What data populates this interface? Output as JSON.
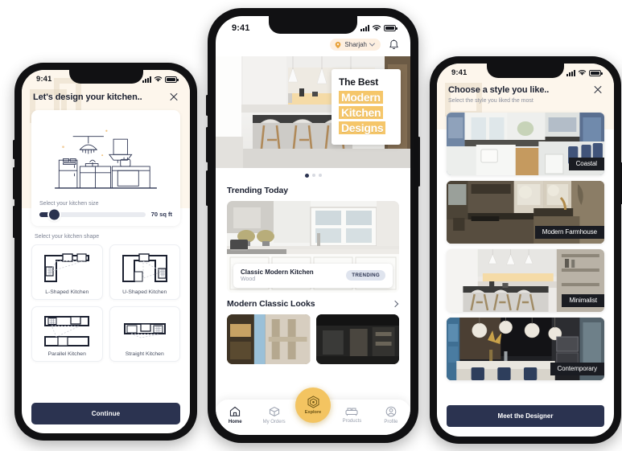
{
  "app": {
    "accent_yellow": "#f3c461",
    "navy": "#2b3350",
    "cream": "#fdf6ec"
  },
  "left_phone": {
    "status": {
      "time": "9:41",
      "signal_icon": "signal-bars-icon",
      "wifi_icon": "wifi-icon",
      "battery_icon": "battery-icon"
    },
    "header": {
      "title": "Let's design your kitchen..",
      "close_icon": "close-icon"
    },
    "illustration": {
      "name": "kitchen-line-illustration"
    },
    "size": {
      "label": "Select your kitchen size",
      "value": "70 sq ft",
      "slider_percent": 13
    },
    "shape": {
      "label": "Select your kitchen shape",
      "options": [
        {
          "name": "L-Shaped Kitchen",
          "icon": "l-shape-icon"
        },
        {
          "name": "U-Shaped Kitchen",
          "icon": "u-shape-icon"
        },
        {
          "name": "Parallel Kitchen",
          "icon": "parallel-shape-icon"
        },
        {
          "name": "Straight Kitchen",
          "icon": "straight-shape-icon"
        }
      ]
    },
    "cta": "Continue"
  },
  "center_phone": {
    "status": {
      "time": "9:41"
    },
    "topbar": {
      "location": "Sharjah",
      "location_icon": "location-pin-icon",
      "chevron_icon": "chevron-down-icon",
      "bell_icon": "notification-bell-icon"
    },
    "hero": {
      "image": "modern-kitchen-hero-photo",
      "tag_line1": "The Best",
      "tag_line2": "Modern",
      "tag_line3": "Kitchen",
      "tag_line4": "Designs",
      "dots_total": 3,
      "dots_active": 1
    },
    "trending": {
      "title": "Trending Today",
      "card": {
        "image": "classic-white-kitchen-photo",
        "name": "Classic Modern Kitchen",
        "material": "Wood",
        "badge": "TRENDING"
      }
    },
    "looks": {
      "title": "Modern Classic Looks",
      "chevron_icon": "chevron-right-icon",
      "cards": [
        {
          "image": "warm-wood-interior-photo"
        },
        {
          "image": "dark-modern-interior-photo"
        }
      ]
    },
    "tabbar": {
      "items": [
        {
          "label": "Home",
          "icon": "home-icon",
          "active": true
        },
        {
          "label": "My Orders",
          "icon": "box-icon",
          "active": false
        },
        {
          "label": "Products",
          "icon": "sofa-icon",
          "active": false
        },
        {
          "label": "Profile",
          "icon": "user-circle-icon",
          "active": false
        }
      ],
      "fab": {
        "label": "Explore",
        "icon": "explore-badge-icon"
      }
    }
  },
  "right_phone": {
    "status": {
      "time": "9:41"
    },
    "header": {
      "title": "Choose a style you like..",
      "subtitle": "Select the style you liked the most",
      "close_icon": "close-icon"
    },
    "styles": [
      {
        "name": "Coastal",
        "image": "coastal-kitchen-photo"
      },
      {
        "name": "Modern Farmhouse",
        "image": "modern-farmhouse-kitchen-photo"
      },
      {
        "name": "Minimalist",
        "image": "minimalist-kitchen-photo"
      },
      {
        "name": "Contemporary",
        "image": "contemporary-kitchen-photo"
      }
    ],
    "cta": "Meet the Designer"
  }
}
